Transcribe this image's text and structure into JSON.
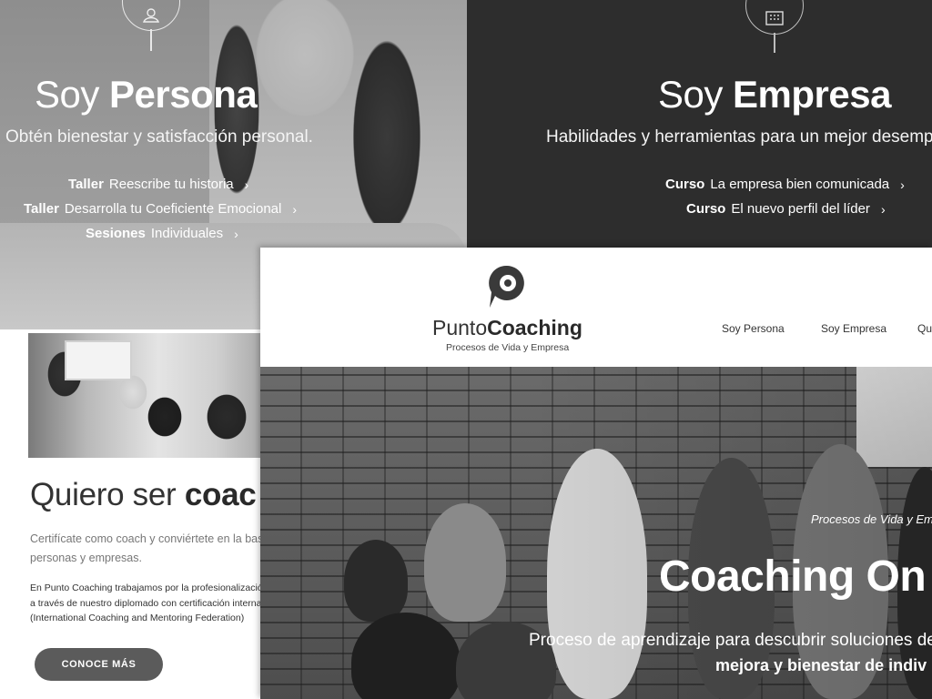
{
  "persona": {
    "title_light": "Soy",
    "title_bold": "Persona",
    "subtitle": "Obtén bienestar y satisfacción personal.",
    "icon": "person-icon",
    "items": [
      {
        "bold": "Taller",
        "text": "Reescribe tu historia"
      },
      {
        "bold": "Taller",
        "text": "Desarrolla tu Coeficiente Emocional"
      },
      {
        "bold": "Sesiones",
        "text": "Individuales"
      }
    ]
  },
  "empresa": {
    "title_light": "Soy",
    "title_bold": "Empresa",
    "subtitle": "Habilidades y herramientas para un mejor desempeñ",
    "icon": "building-icon",
    "items": [
      {
        "bold": "Curso",
        "text": "La empresa bien comunicada"
      },
      {
        "bold": "Curso",
        "text": "El nuevo perfil del líder"
      }
    ]
  },
  "coach": {
    "title_light": "Quiero ser",
    "title_bold": "coac",
    "text_lines": [
      "Certifícate como coach y conviértete en la base de",
      "personas y empresas."
    ],
    "small_lines": [
      "En Punto Coaching trabajamos por la profesionalización de",
      "a través de nuestro diplomado con certificación internacion",
      "(International Coaching and Mentoring Federation)"
    ],
    "button": "CONOCE MÁS"
  },
  "home": {
    "logo_light": "Punto",
    "logo_bold": "Coaching",
    "tagline": "Procesos de Vida y Empresa",
    "nav": [
      "Soy Persona",
      "Soy Empresa",
      "Qu"
    ],
    "hero": {
      "kicker": "Procesos de Vida y Emp",
      "title": "Coaching On",
      "desc_line1": "Proceso de aprendizaje para descubrir soluciones de r",
      "desc_line2": "mejora y bienestar de indiv"
    }
  }
}
